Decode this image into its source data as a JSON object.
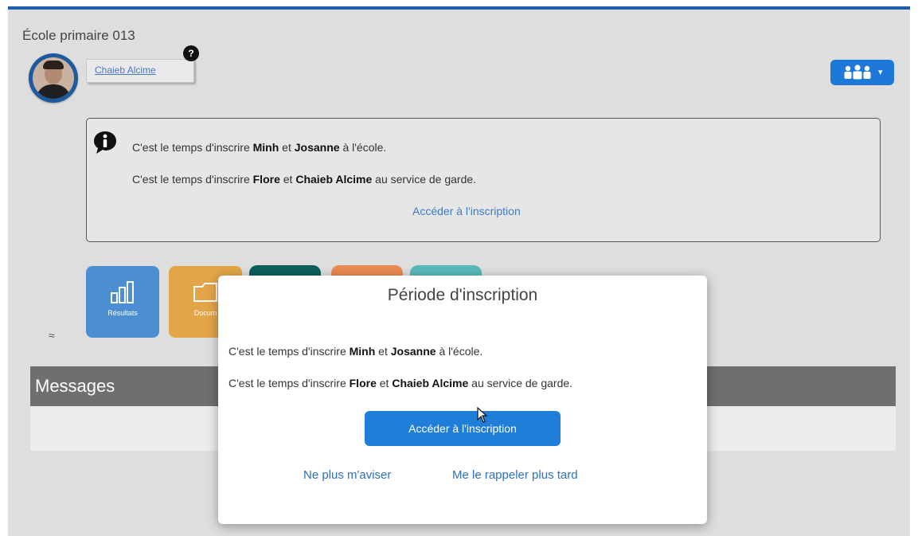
{
  "header": {
    "school_name": "École primaire 013",
    "user_name": "Chaieb Alcime",
    "help_badge": "?",
    "group_menu_caret": "▾"
  },
  "notice": {
    "line1": {
      "pre": "C'est le temps d'inscrire ",
      "name1": "Minh",
      "mid": " et ",
      "name2": "Josanne",
      "post": " à l'école."
    },
    "line2": {
      "pre": "C'est le temps d'inscrire ",
      "name1": "Flore",
      "mid": " et ",
      "name2": "Chaieb Alcime",
      "post": " au service de garde."
    },
    "link": "Accéder à l'inscription"
  },
  "tiles": {
    "results_label": "Résultats",
    "documents_label": "Docum"
  },
  "messages": {
    "title": "Messages"
  },
  "modal": {
    "title": "Période d'inscription",
    "line1": {
      "pre": "C'est le temps d'inscrire ",
      "name1": "Minh",
      "mid": " et ",
      "name2": "Josanne",
      "post": " à l'école."
    },
    "line2": {
      "pre": "C'est le temps d'inscrire ",
      "name1": "Flore",
      "mid": " et ",
      "name2": "Chaieb Alcime",
      "post": " au service de garde."
    },
    "primary_button": "Accéder à l'inscription",
    "dismiss_link": "Ne plus m'aviser",
    "later_link": "Me le rappeler plus tard"
  },
  "colors": {
    "accent": "#1f7fd8",
    "header_bar": "#1f5ea8",
    "link": "#2d6fc0",
    "tile_results": "#4c8ed2",
    "tile_documents": "#e3a548"
  },
  "icons": [
    "help-icon",
    "group-icon",
    "info-icon",
    "chart-icon",
    "folder-icon",
    "collapse-icon",
    "mouse-cursor-icon"
  ]
}
